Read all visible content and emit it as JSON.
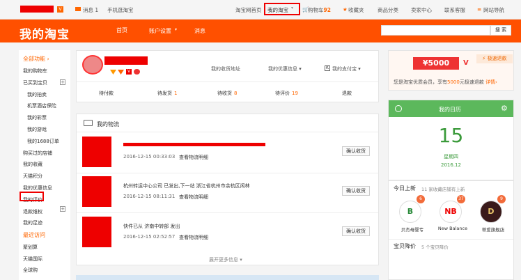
{
  "topbar": {
    "message": "消息",
    "message_count": "1",
    "mobile": "手机逛淘宝",
    "home": "淘宝网首页",
    "my_taobao": "我的淘宝",
    "cart": "购物车",
    "cart_count": "92",
    "fav": "收藏夹",
    "category": "商品分类",
    "seller": "卖家中心",
    "service": "联系客服",
    "sitenav": "网站导航"
  },
  "header": {
    "logo": "我的淘宝",
    "nav": [
      "首页",
      "账户设置",
      "消息"
    ],
    "search_button": "搜 索"
  },
  "sidebar": {
    "all": "全部功能",
    "items": [
      {
        "label": "我的购物车",
        "indent": false
      },
      {
        "label": "已买到宝贝",
        "indent": false
      },
      {
        "label": "我的拍卖",
        "indent": true
      },
      {
        "label": "机票酒店保险",
        "indent": true
      },
      {
        "label": "我的彩票",
        "indent": true
      },
      {
        "label": "我的游戏",
        "indent": true
      },
      {
        "label": "我的1688订单",
        "indent": true
      },
      {
        "label": "购买过的店铺",
        "indent": false
      },
      {
        "label": "我的收藏",
        "indent": false
      },
      {
        "label": "天猫积分",
        "indent": false
      },
      {
        "label": "我的优惠信息",
        "indent": false
      },
      {
        "label": "我的评价",
        "indent": false
      },
      {
        "label": "退款维权",
        "indent": false
      },
      {
        "label": "我的足迹",
        "indent": false
      }
    ],
    "recent": "最近访问",
    "recent_items": [
      "聚划算",
      "天猫国际",
      "全球购"
    ]
  },
  "profile": {
    "address": "我的收货地址",
    "coupons": "我的优惠信息",
    "alipay": "我的支付宝"
  },
  "orders": [
    {
      "label": "待付款",
      "count": ""
    },
    {
      "label": "待发货",
      "count": "1"
    },
    {
      "label": "待收货",
      "count": "8"
    },
    {
      "label": "待评价",
      "count": "19"
    },
    {
      "label": "退款",
      "count": ""
    }
  ],
  "logistics": {
    "title": "我的物流",
    "items": [
      {
        "status": "",
        "time": "2016-12-15 00:33:03",
        "link": "查看物流明细",
        "button": "确认收货"
      },
      {
        "status": "杭州转运中心公司 已发出,下一站 浙江省杭州市余杭区闲林",
        "time": "2016-12-15 08:11:31",
        "link": "查看物流明细",
        "button": "确认收货"
      },
      {
        "status": "快件已从 济南中转部 发出",
        "time": "2016-12-15 02:52:57",
        "link": "查看物流明细",
        "button": "确认收货"
      }
    ],
    "more": "展开更多信息"
  },
  "promo": {
    "amount": "¥5000",
    "tag": "极速退款",
    "text_a": "您是淘宝优质会员，享有",
    "text_amount": "5000",
    "text_b": "元极速退款",
    "details": "详情›"
  },
  "calendar": {
    "title": "我的日历",
    "day": "15",
    "weekday": "星期四",
    "month": "2016.12"
  },
  "today": {
    "title": "今日上新",
    "subtitle": "11 家收藏店铺有上新",
    "brands": [
      {
        "name": "贝杰母婴专",
        "badge": "6",
        "letter": "B"
      },
      {
        "name": "New Balance",
        "badge": "37",
        "letter": "NB"
      },
      {
        "name": "蒂爱旗舰店",
        "badge": "9",
        "letter": "D"
      }
    ]
  },
  "price_drop": {
    "title": "宝贝降价",
    "subtitle": "5 个宝贝降价"
  },
  "colors": {
    "brand": "#ff5000",
    "calendar": "#5cb85c",
    "highlight": "#ee0000"
  }
}
